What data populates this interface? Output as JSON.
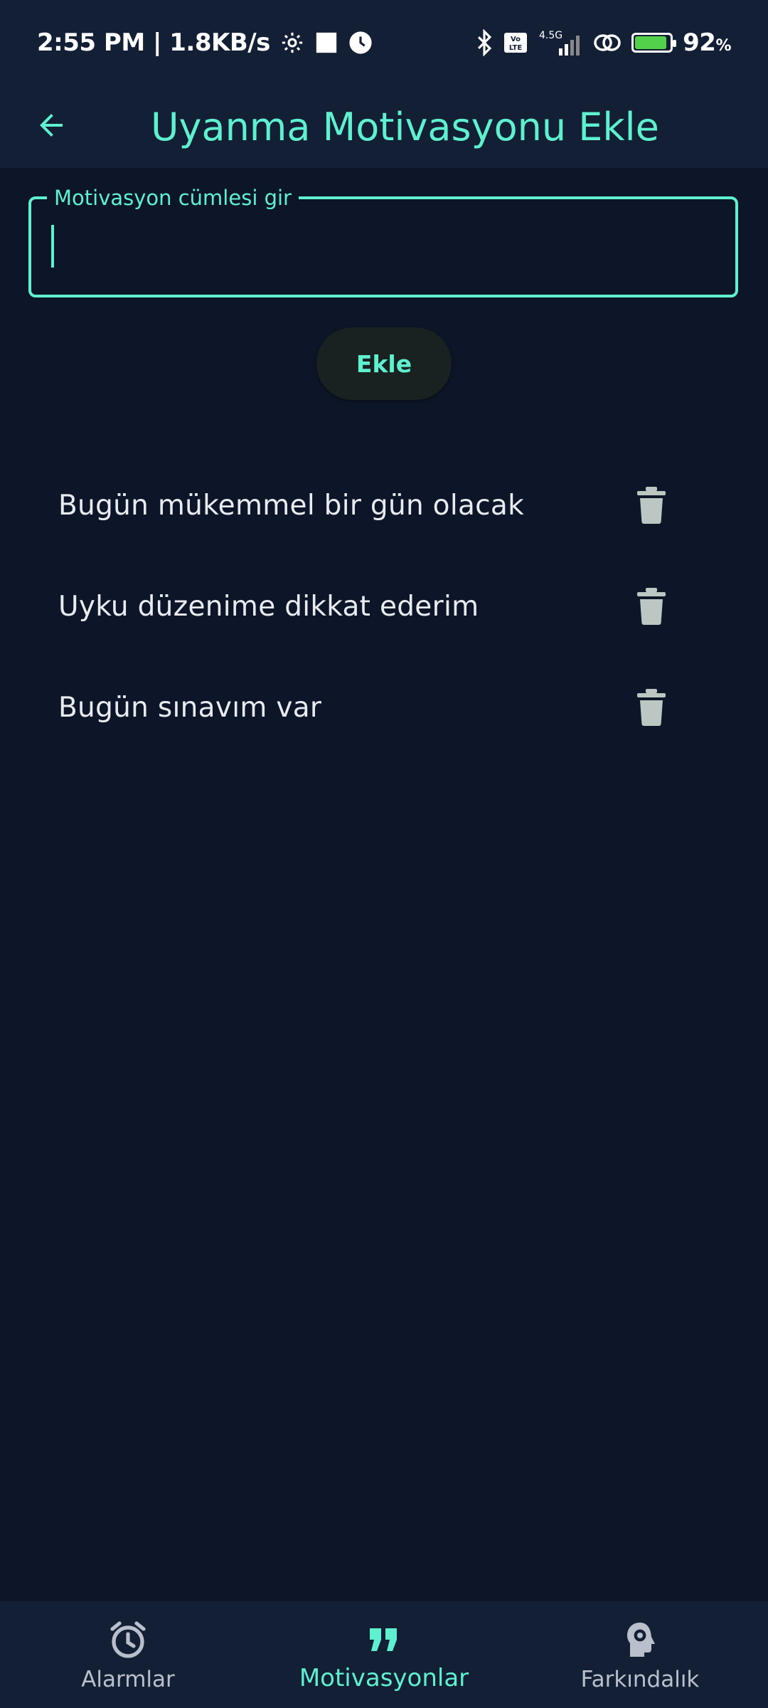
{
  "status_bar": {
    "time": "2:55 PM | 1.8KB/s",
    "network_label": "4.5G",
    "volte_label": "Vo LTE",
    "battery_percent": "92",
    "percent_sign": "%",
    "battery_level": 0.92,
    "battery_color": "#54d14a"
  },
  "app_bar": {
    "title": "Uyanma Motivasyonu Ekle",
    "back_icon": "arrow-back-icon"
  },
  "input": {
    "label": "Motivasyon cümlesi gir",
    "value": ""
  },
  "add_button": {
    "label": "Ekle"
  },
  "motivations": [
    {
      "text": "Bugün mükemmel bir gün olacak",
      "icon": "trash-icon"
    },
    {
      "text": "Uyku düzenime dikkat ederim",
      "icon": "trash-icon"
    },
    {
      "text": "Bugün sınavım var",
      "icon": "trash-icon"
    }
  ],
  "bottom_nav": {
    "items": [
      {
        "label": "Alarmlar",
        "icon": "alarm-clock-icon",
        "active": false
      },
      {
        "label": "Motivasyonlar",
        "icon": "quote-icon",
        "active": true
      },
      {
        "label": "Farkındalık",
        "icon": "head-gear-icon",
        "active": false
      }
    ]
  },
  "colors": {
    "accent": "#5ff0cf",
    "background": "#0d1628",
    "bar_background": "#131f35",
    "icon_gray": "#bcc6c2"
  }
}
